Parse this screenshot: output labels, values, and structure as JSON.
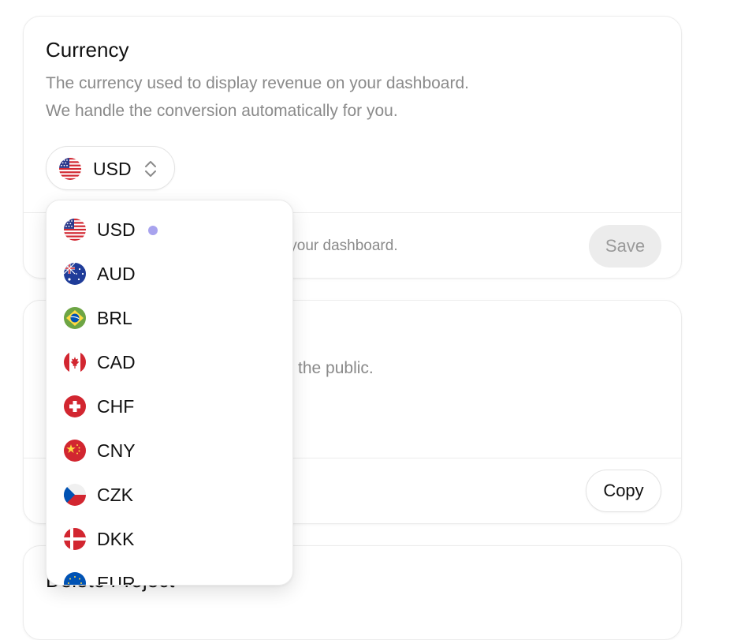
{
  "currency": {
    "title": "Currency",
    "description_line1": "The currency used to display revenue on your dashboard.",
    "description_line2": "We handle the conversion automatically for you.",
    "selected": {
      "code": "USD",
      "flag_icon": "us-flag-icon"
    },
    "footer_text": "ss your dashboard.",
    "save_label": "Save"
  },
  "public_card": {
    "description_partial": "the public.",
    "copy_label": "Copy"
  },
  "delete_card": {
    "title_partial": "Delete Project"
  },
  "dropdown": {
    "options": [
      {
        "code": "USD",
        "flag_icon": "us-flag-icon",
        "selected": true
      },
      {
        "code": "AUD",
        "flag_icon": "au-flag-icon"
      },
      {
        "code": "BRL",
        "flag_icon": "br-flag-icon"
      },
      {
        "code": "CAD",
        "flag_icon": "ca-flag-icon"
      },
      {
        "code": "CHF",
        "flag_icon": "ch-flag-icon"
      },
      {
        "code": "CNY",
        "flag_icon": "cn-flag-icon"
      },
      {
        "code": "CZK",
        "flag_icon": "cz-flag-icon"
      },
      {
        "code": "DKK",
        "flag_icon": "dk-flag-icon"
      },
      {
        "code": "EUR",
        "flag_icon": "eu-flag-icon"
      }
    ],
    "selected_indicator_color": "#a8a3ee"
  },
  "colors": {
    "text_primary": "#111111",
    "text_muted": "#8a8a8a",
    "border": "#ececec",
    "save_disabled_bg": "#ececec"
  }
}
